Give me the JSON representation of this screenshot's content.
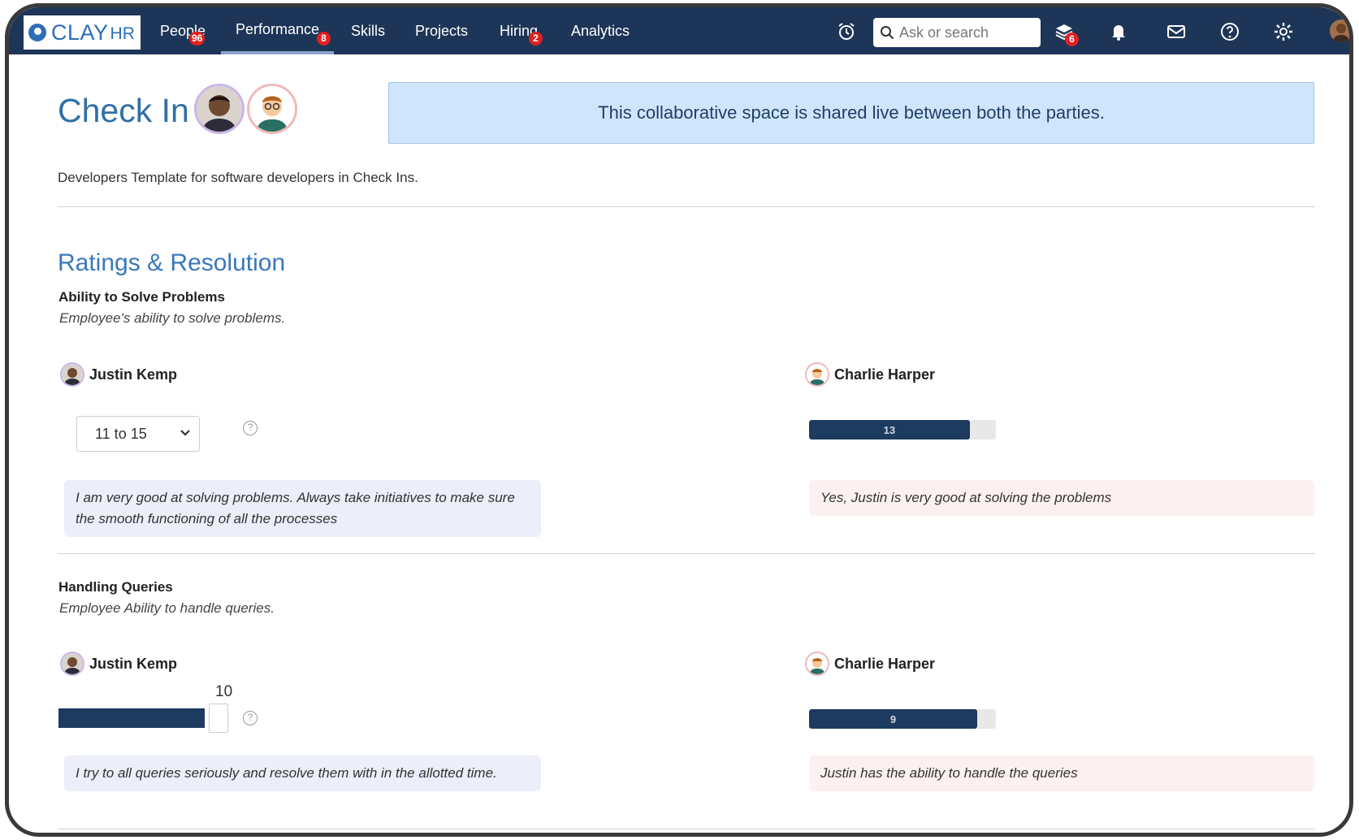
{
  "app": {
    "logo_text": "CLAY",
    "logo_sub": "HR"
  },
  "nav": {
    "items": [
      {
        "label": "People",
        "badge": "96"
      },
      {
        "label": "Performance",
        "badge": "8"
      },
      {
        "label": "Skills",
        "badge": ""
      },
      {
        "label": "Projects",
        "badge": ""
      },
      {
        "label": "Hiring",
        "badge": "2"
      },
      {
        "label": "Analytics",
        "badge": ""
      }
    ],
    "active": "Performance",
    "search_placeholder": "Ask or search",
    "layers_badge": "6",
    "icons": [
      "alarm-icon",
      "search-icon",
      "layers-icon",
      "bell-icon",
      "mail-icon",
      "help-icon",
      "gear-icon",
      "user-avatar"
    ]
  },
  "header": {
    "title": "Check In",
    "banner": "This collaborative space is shared live between both the parties.",
    "description": "Developers Template for software developers in Check Ins."
  },
  "section": {
    "title": "Ratings & Resolution"
  },
  "questions": [
    {
      "title": "Ability to Solve Problems",
      "subtitle": "Employee's ability to solve problems.",
      "employee": {
        "name": "Justin Kemp",
        "select_value": "11 to 15",
        "comment": "I am very good at solving problems. Always take initiatives to make sure the smooth functioning of all the processes"
      },
      "manager": {
        "name": "Charlie Harper",
        "rating_label": "13",
        "rating_fraction": 0.86,
        "comment": "Yes, Justin is very good at solving the problems"
      }
    },
    {
      "title": "Handling Queries",
      "subtitle": "Employee Ability to handle queries.",
      "employee": {
        "name": "Justin Kemp",
        "slider_value": "10",
        "comment": "I try to all queries seriously and resolve them with in the allotted time."
      },
      "manager": {
        "name": "Charlie Harper",
        "rating_label": "9",
        "rating_fraction": 0.9,
        "comment": "Justin has the ability to handle the queries"
      }
    }
  ],
  "colors": {
    "nav_bg": "#1d3557",
    "accent": "#2f6fa8",
    "badge": "#e02020",
    "bar_fill": "#1d3a5f"
  }
}
